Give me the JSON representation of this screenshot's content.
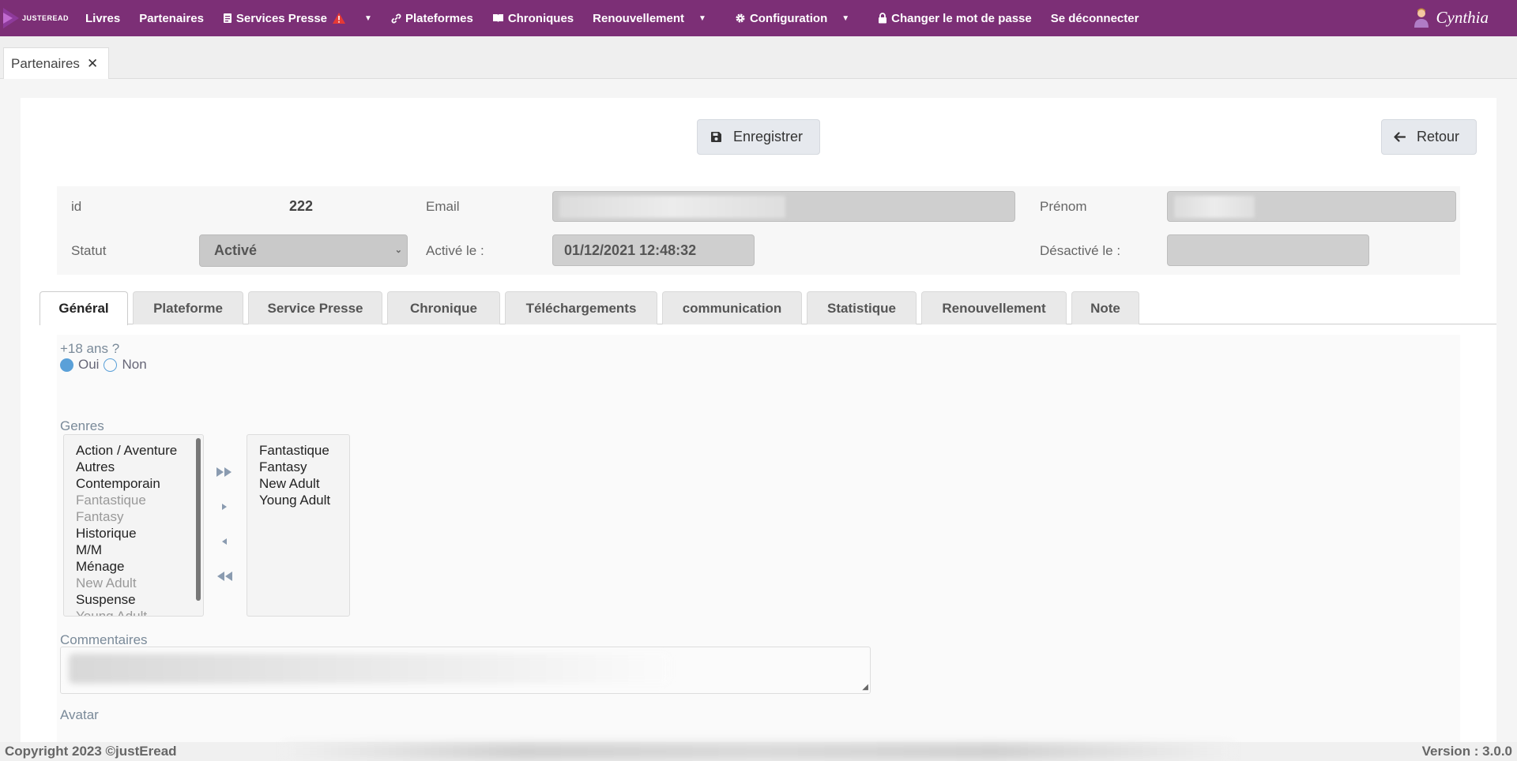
{
  "navbar": {
    "logo_text": "JUSTEREAD",
    "items": [
      {
        "label": "Livres",
        "icon": ""
      },
      {
        "label": "Partenaires",
        "icon": ""
      },
      {
        "label": "Services Presse",
        "icon": "document-icon"
      },
      {
        "label": "Plateformes",
        "icon": "link-icon"
      },
      {
        "label": "Chroniques",
        "icon": "book-icon"
      },
      {
        "label": "Renouvellement",
        "icon": ""
      },
      {
        "label": "Configuration",
        "icon": "gear-icon"
      },
      {
        "label": "Changer le mot de passe",
        "icon": "lock-icon"
      },
      {
        "label": "Se déconnecter",
        "icon": ""
      }
    ],
    "user_name": "Cynthia"
  },
  "page_tabs": [
    {
      "label": "Partenaires"
    }
  ],
  "toolbar": {
    "save_label": "Enregistrer",
    "back_label": "Retour"
  },
  "info": {
    "id_label": "id",
    "id_value": "222",
    "email_label": "Email",
    "prenom_label": "Prénom",
    "statut_label": "Statut",
    "statut_value": "Activé",
    "active_label": "Activé le :",
    "active_value": "01/12/2021 12:48:32",
    "desactive_label": "Désactivé le :"
  },
  "tabs": [
    "Général",
    "Plateforme",
    "Service Presse",
    "Chronique",
    "Téléchargements",
    "communication",
    "Statistique",
    "Renouvellement",
    "Note"
  ],
  "general": {
    "age_question": "+18 ans ?",
    "age_options": [
      "Oui",
      "Non"
    ],
    "age_selected": "Oui",
    "genres_label": "Genres",
    "available_genres": [
      {
        "label": "Action / Aventure",
        "disabled": false
      },
      {
        "label": "Autres",
        "disabled": false
      },
      {
        "label": "Contemporain",
        "disabled": false
      },
      {
        "label": "Fantastique",
        "disabled": true
      },
      {
        "label": "Fantasy",
        "disabled": true
      },
      {
        "label": "Historique",
        "disabled": false
      },
      {
        "label": "M/M",
        "disabled": false
      },
      {
        "label": "Ménage",
        "disabled": false
      },
      {
        "label": "New Adult",
        "disabled": true
      },
      {
        "label": "Suspense",
        "disabled": false
      },
      {
        "label": "Young Adult",
        "disabled": true
      }
    ],
    "selected_genres": [
      "Fantastique",
      "Fantasy",
      "New Adult",
      "Young Adult"
    ],
    "comments_label": "Commentaires",
    "avatar_label": "Avatar"
  },
  "footer": {
    "copyright": "Copyright 2023 ©justEread",
    "version": "Version : 3.0.0"
  },
  "colors": {
    "navbar": "#7c2f76",
    "accent": "#5aa0d8",
    "warning": "#e53935"
  }
}
